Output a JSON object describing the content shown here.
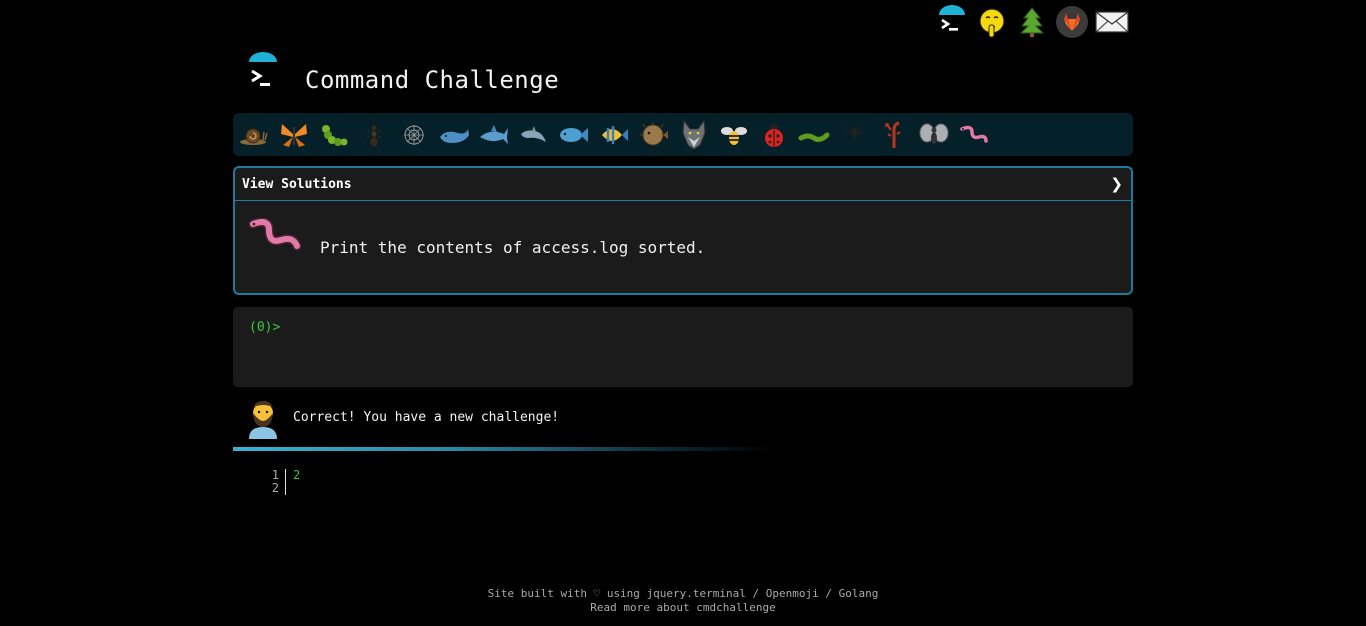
{
  "top_nav": [
    {
      "icon": "terminal-icon"
    },
    {
      "icon": "shush-face-icon"
    },
    {
      "icon": "tree-icon"
    },
    {
      "icon": "gitlab-icon"
    },
    {
      "icon": "mail-icon"
    }
  ],
  "header": {
    "title": "Command Challenge"
  },
  "critters": [
    "snail",
    "butterfly",
    "caterpillar",
    "ant",
    "web",
    "whale",
    "shark",
    "dolphin",
    "fish",
    "tropical-fish",
    "blowfish",
    "wolf",
    "bee",
    "ladybug",
    "worm-green",
    "spider",
    "scorpion",
    "fly",
    "worm-pink"
  ],
  "panel": {
    "header_label": "View Solutions",
    "toggle_glyph": "❯",
    "challenge_text": "Print the contents of access.log sorted."
  },
  "terminal": {
    "prompt": "(0)>"
  },
  "feedback": {
    "message": "Correct! You have a new challenge!"
  },
  "editor": {
    "line_numbers": [
      "1",
      "2"
    ],
    "lines": [
      "2",
      ""
    ]
  },
  "footer": {
    "prefix": "Site built with ♡ using ",
    "link1": "jquery.terminal",
    "sep1": " / ",
    "link2": "Openmoji",
    "sep2": " / ",
    "link3": "Golang",
    "line2": "Read more about cmdchallenge"
  },
  "colors": {
    "accent": "#1d7c9a",
    "prompt": "#3ac63a",
    "critter_bar": "#062029",
    "panel_bg": "#1b1b1b"
  }
}
